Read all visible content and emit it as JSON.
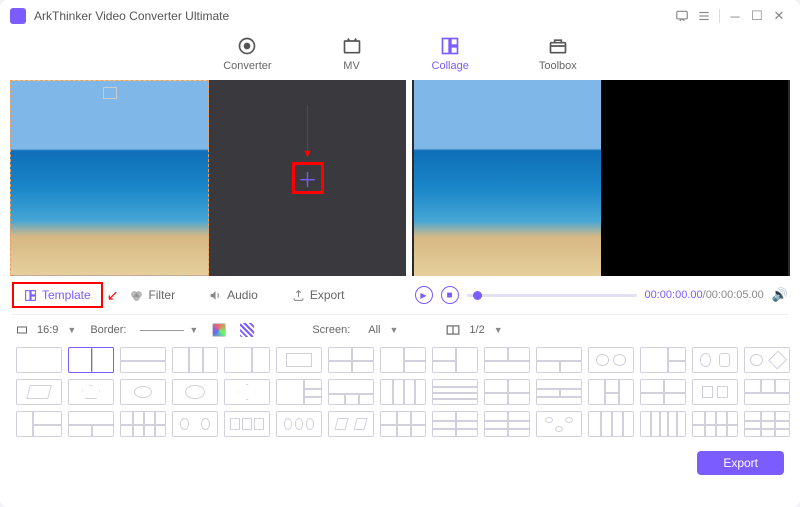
{
  "app": {
    "title": "ArkThinker Video Converter Ultimate"
  },
  "nav": {
    "converter": "Converter",
    "mv": "MV",
    "collage": "Collage",
    "toolbox": "Toolbox"
  },
  "tabs": {
    "template": "Template",
    "filter": "Filter",
    "audio": "Audio",
    "export": "Export"
  },
  "player": {
    "current": "00:00:00.00",
    "total": "00:00:05.00"
  },
  "options": {
    "ratio": "16:9",
    "border_label": "Border:",
    "screen_label": "Screen:",
    "screen_value": "All",
    "split_value": "1/2"
  },
  "footer": {
    "export": "Export"
  }
}
